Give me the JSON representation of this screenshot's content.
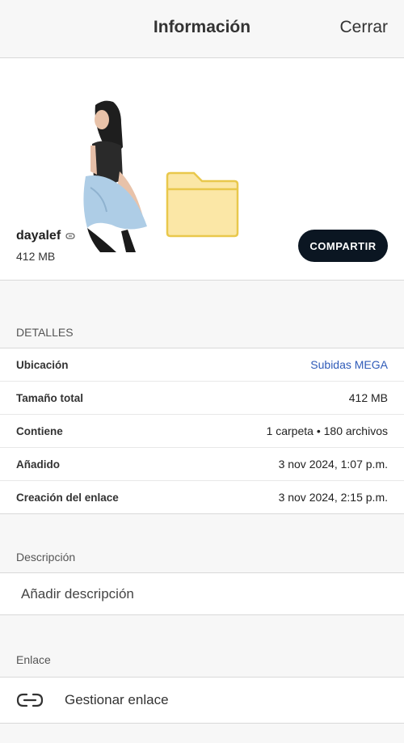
{
  "header": {
    "title": "Información",
    "close_label": "Cerrar"
  },
  "file": {
    "name": "dayalef",
    "size": "412 MB",
    "share_label": "COMPARTIR"
  },
  "details": {
    "heading": "DETALLES",
    "rows": [
      {
        "label": "Ubicación",
        "value": "Subidas MEGA"
      },
      {
        "label": "Tamaño total",
        "value": "412 MB"
      },
      {
        "label": "Contiene",
        "value": "1 carpeta • 180 archivos"
      },
      {
        "label": "Añadido",
        "value": "3 nov 2024, 1:07 p.m."
      },
      {
        "label": "Creación del enlace",
        "value": "3 nov 2024, 2:15 p.m."
      }
    ]
  },
  "description": {
    "heading": "Descripción",
    "placeholder": "Añadir descripción"
  },
  "link": {
    "heading": "Enlace",
    "manage_label": "Gestionar enlace"
  },
  "colors": {
    "accent_link": "#2f5bb8",
    "button_bg": "#0b1622",
    "folder_fill": "#fbe7a6",
    "folder_stroke": "#e9c84c"
  }
}
